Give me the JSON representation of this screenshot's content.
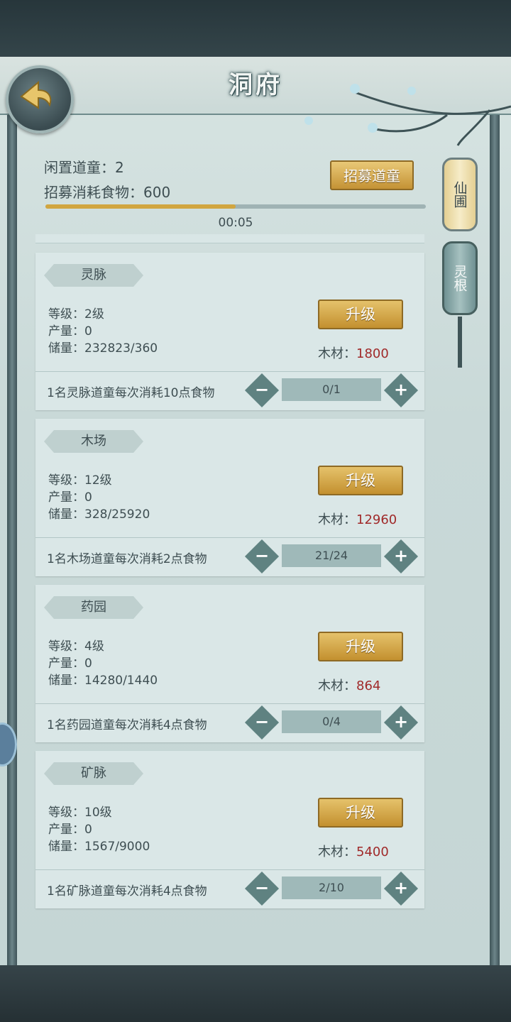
{
  "header": {
    "title": "洞府"
  },
  "recruit": {
    "idle_label": "闲置道童：2",
    "cost_label": "招募消耗食物：600",
    "button": "招募道童",
    "progress": 0.5,
    "timer": "00:05"
  },
  "side_tabs": [
    {
      "label": "仙圃"
    },
    {
      "label": "灵根"
    }
  ],
  "cards": [
    {
      "name": "灵脉",
      "level": "等级：2级",
      "output": "产量：0",
      "storage": "储量：232823/360",
      "upgrade": "升级",
      "cost_label": "木材：",
      "cost_value": "1800",
      "desc": "1名灵脉道童每次消耗10点食物",
      "workers": "0/1"
    },
    {
      "name": "木场",
      "level": "等级：12级",
      "output": "产量：0",
      "storage": "储量：328/25920",
      "upgrade": "升级",
      "cost_label": "木材：",
      "cost_value": "12960",
      "desc": "1名木场道童每次消耗2点食物",
      "workers": "21/24"
    },
    {
      "name": "药园",
      "level": "等级：4级",
      "output": "产量：0",
      "storage": "储量：14280/1440",
      "upgrade": "升级",
      "cost_label": "木材：",
      "cost_value": "864",
      "desc": "1名药园道童每次消耗4点食物",
      "workers": "0/4"
    },
    {
      "name": "矿脉",
      "level": "等级：10级",
      "output": "产量：0",
      "storage": "储量：1567/9000",
      "upgrade": "升级",
      "cost_label": "木材：",
      "cost_value": "5400",
      "desc": "1名矿脉道童每次消耗4点食物",
      "workers": "2/10"
    }
  ],
  "stepper": {
    "minus": "−",
    "plus": "+"
  },
  "colors": {
    "accent_gold": "#c9983a",
    "cost_red": "#a02a2a",
    "teal": "#5f8281"
  },
  "icons": {
    "back": "back-arrow-icon",
    "minus": "minus-icon",
    "plus": "plus-icon"
  }
}
